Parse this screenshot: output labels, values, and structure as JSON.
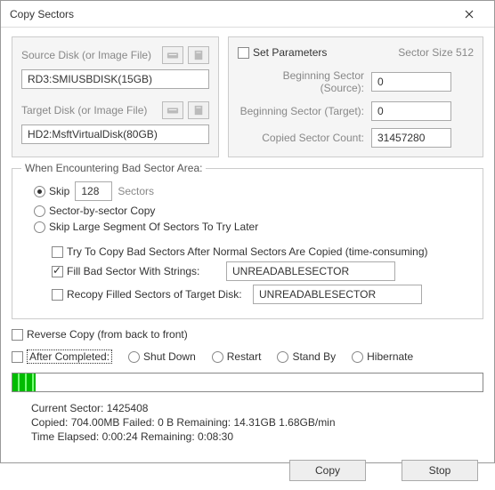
{
  "window": {
    "title": "Copy Sectors"
  },
  "left": {
    "source_label": "Source Disk (or Image File)",
    "source_value": "RD3:SMIUSBDISK(15GB)",
    "target_label": "Target Disk (or Image File)",
    "target_value": "HD2:MsftVirtualDisk(80GB)"
  },
  "right": {
    "set_params": "Set Parameters",
    "sector_size": "Sector Size 512",
    "beg_src_label": "Beginning Sector (Source):",
    "beg_src_value": "0",
    "beg_tgt_label": "Beginning Sector (Target):",
    "beg_tgt_value": "0",
    "count_label": "Copied Sector Count:",
    "count_value": "31457280"
  },
  "bad": {
    "legend": "When Encountering Bad Sector Area:",
    "skip": "Skip",
    "skip_value": "128",
    "sectors": "Sectors",
    "sbs": "Sector-by-sector Copy",
    "skip_large": "Skip Large Segment Of Sectors To Try Later",
    "try_copy": "Try To Copy Bad Sectors After Normal Sectors Are Copied (time-consuming)",
    "fill": "Fill Bad Sector With Strings:",
    "fill_value": "UNREADABLESECTOR",
    "recopy": "Recopy Filled Sectors of Target Disk:",
    "recopy_value": "UNREADABLESECTOR"
  },
  "reverse": "Reverse Copy (from back to front)",
  "after": {
    "label": "After Completed:",
    "o1": "Shut Down",
    "o2": "Restart",
    "o3": "Stand By",
    "o4": "Hibernate"
  },
  "progress_pct": 5,
  "stats": {
    "l1": "Current Sector: 1425408",
    "l2": "Copied: 704.00MB  Failed: 0 B  Remaining: 14.31GB  1.68GB/min",
    "l3": "Time Elapsed:  0:00:24  Remaining:  0:08:30"
  },
  "buttons": {
    "copy": "Copy",
    "stop": "Stop"
  }
}
